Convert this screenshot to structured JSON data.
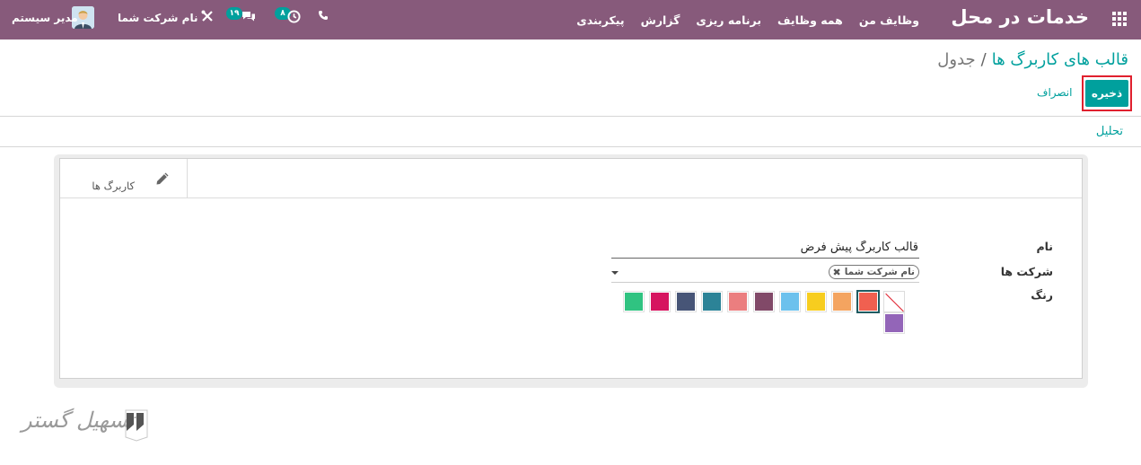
{
  "topbar": {
    "app_title": "خدمات در محل",
    "menu": [
      "وظایف من",
      "همه وظایف",
      "برنامه ریزی",
      "گزارش",
      "پیکربندی"
    ],
    "activity_count": "۸",
    "messages_count": "۱۹",
    "company_name": "نام شرکت شما",
    "user_name": "مدیر سیستم",
    "icons": [
      "apps-icon",
      "phone-icon",
      "clock-icon",
      "chat-icon",
      "tools-icon",
      "avatar"
    ]
  },
  "breadcrumb": {
    "parent": "قالب های کاربرگ ها",
    "separator": "/",
    "current": "جدول"
  },
  "buttons": {
    "save": "ذخیره",
    "discard": "انصراف"
  },
  "action_link": "تحلیل",
  "stat_button": {
    "label": "کاربرگ ها",
    "icon": "pencil-icon"
  },
  "form": {
    "name_label": "نام",
    "name_value": "قالب کاربرگ پیش فرض",
    "companies_label": "شرکت ها",
    "companies_tags": [
      "نام شرکت شما"
    ],
    "color_label": "رنگ",
    "colors": [
      {
        "name": "no-color",
        "hex": "#ffffff"
      },
      {
        "name": "red",
        "hex": "#f06050"
      },
      {
        "name": "orange",
        "hex": "#f4a460"
      },
      {
        "name": "yellow",
        "hex": "#f7cd1f"
      },
      {
        "name": "light-blue",
        "hex": "#6cc1ed"
      },
      {
        "name": "dark-purple",
        "hex": "#814968"
      },
      {
        "name": "salmon-pink",
        "hex": "#eb7e7f"
      },
      {
        "name": "medium-blue",
        "hex": "#2c8397"
      },
      {
        "name": "dark-blue",
        "hex": "#475577"
      },
      {
        "name": "fuchsia",
        "hex": "#d6145f"
      },
      {
        "name": "green",
        "hex": "#30c381"
      },
      {
        "name": "purple",
        "hex": "#9365b8"
      }
    ],
    "selected_color": "red"
  },
  "watermark": {
    "text": "تسهیل گستر"
  }
}
